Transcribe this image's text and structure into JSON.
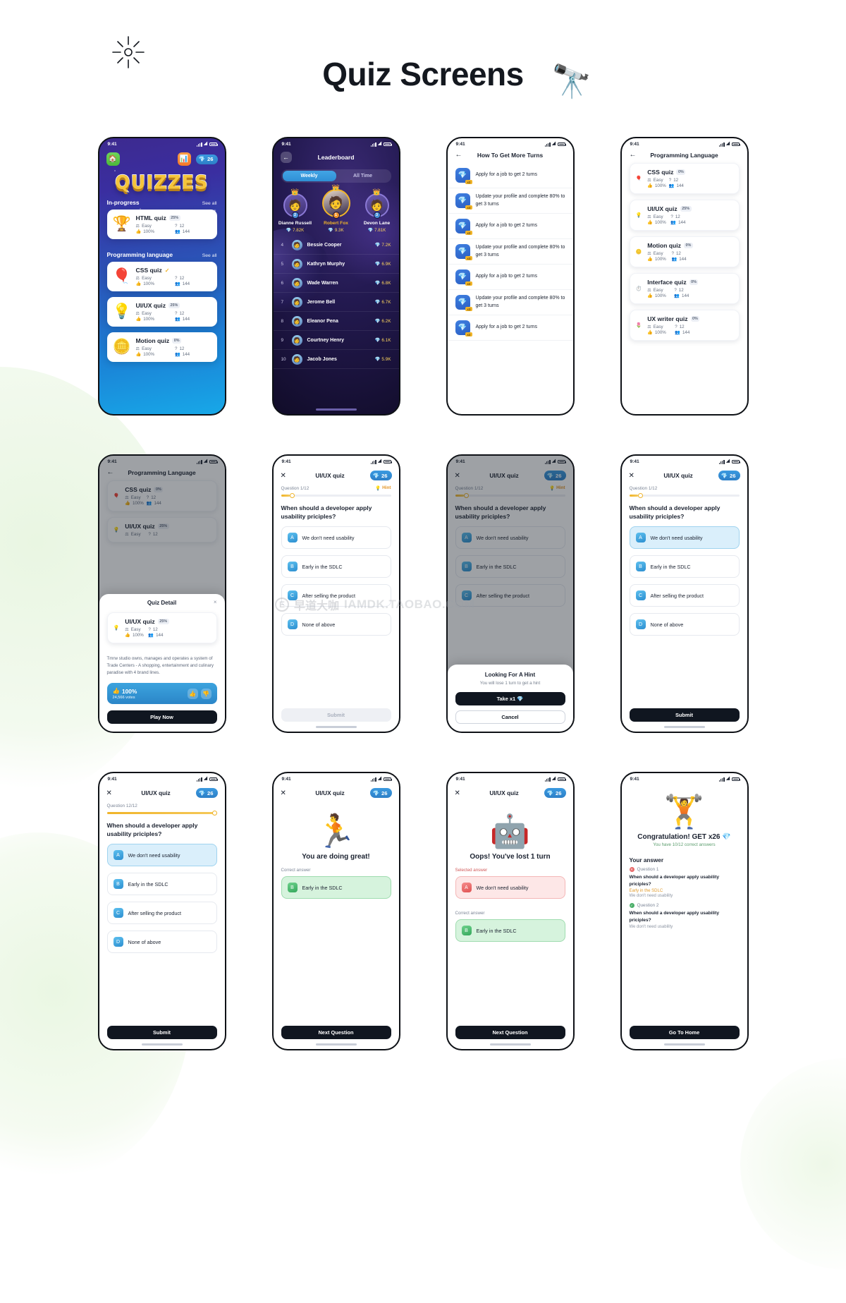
{
  "header": {
    "title": "Quiz Screens",
    "sun_icon": "sun-icon",
    "binoculars_icon": "🔭"
  },
  "watermark": {
    "logo": "E",
    "text_cn": "早道大咖",
    "text_en": "IAMDK.TAOBAO.COM"
  },
  "status_bar": {
    "time": "9:41"
  },
  "screen1": {
    "logo": "QUIZZES",
    "home_icon": "🏠",
    "ranking_icon": "📊",
    "gems": "26",
    "gem_icon": "💎",
    "sections": [
      {
        "title": "In-progress",
        "link": "See all"
      },
      {
        "title": "Programming language",
        "link": "See all"
      }
    ],
    "cards": [
      {
        "emoji": "🏆",
        "title": "HTML quiz",
        "badge": "25%",
        "difficulty": "Easy",
        "questions": "12",
        "rate": "100%",
        "players": "144"
      },
      {
        "emoji": "🎈",
        "title": "CSS quiz",
        "badge": "✓",
        "badge_done": true,
        "difficulty": "Easy",
        "questions": "12",
        "rate": "100%",
        "players": "144"
      },
      {
        "emoji": "💡",
        "title": "UI/UX quiz",
        "badge": "25%",
        "difficulty": "Easy",
        "questions": "12",
        "rate": "100%",
        "players": "144"
      },
      {
        "emoji": "🪙",
        "title": "Motion quiz",
        "badge": "0%",
        "difficulty": "Easy",
        "questions": "12",
        "rate": "100%",
        "players": "144"
      }
    ]
  },
  "screen2": {
    "title": "Leaderboard",
    "tabs": [
      {
        "label": "Weekly",
        "active": true
      },
      {
        "label": "All Time",
        "active": false
      }
    ],
    "podium": [
      {
        "rank": "2",
        "name": "Dianne Russell",
        "score": "7.82K",
        "avatar": "🧑",
        "crown": "👑"
      },
      {
        "rank": "1",
        "name": "Robert Fox",
        "score": "9.3K",
        "avatar": "🧑",
        "crown": "👑"
      },
      {
        "rank": "3",
        "name": "Devon Lane",
        "score": "7.81K",
        "avatar": "🧑",
        "crown": "👑"
      }
    ],
    "rows": [
      {
        "rank": "4",
        "name": "Bessie Cooper",
        "score": "7.2K",
        "avatar": "🧑"
      },
      {
        "rank": "5",
        "name": "Kathryn Murphy",
        "score": "6.9K",
        "avatar": "🧑"
      },
      {
        "rank": "6",
        "name": "Wade Warren",
        "score": "6.8K",
        "avatar": "🧑"
      },
      {
        "rank": "7",
        "name": "Jerome Bell",
        "score": "6.7K",
        "avatar": "👩"
      },
      {
        "rank": "8",
        "name": "Eleanor Pena",
        "score": "6.2K",
        "avatar": "👩"
      },
      {
        "rank": "9",
        "name": "Courtney Henry",
        "score": "6.1K",
        "avatar": "👩"
      },
      {
        "rank": "10",
        "name": "Jacob Jones",
        "score": "5.9K",
        "avatar": "🧑"
      }
    ]
  },
  "screen3": {
    "title": "How To Get More Turns",
    "gem_icon": "💎",
    "items": [
      {
        "text": "Apply for a job to get 2 turns",
        "mult": "x2"
      },
      {
        "text": "Update your profile and complete 80% to get 3 turns",
        "mult": "x3"
      },
      {
        "text": "Apply for a job to get 2 turns",
        "mult": "x2"
      },
      {
        "text": "Update your profile and complete 80% to get 3 turns",
        "mult": "x3"
      },
      {
        "text": "Apply for a job to get 2 turns",
        "mult": "x2"
      },
      {
        "text": "Update your profile and complete 80% to get 3 turns",
        "mult": "x3"
      },
      {
        "text": "Apply for a job to get 2 turns",
        "mult": "x2"
      }
    ]
  },
  "screen4": {
    "title": "Programming Language",
    "cards": [
      {
        "emoji": "🎈",
        "title": "CSS quiz",
        "badge": "0%",
        "difficulty": "Easy",
        "questions": "12",
        "rate": "100%",
        "players": "144"
      },
      {
        "emoji": "💡",
        "title": "UI/UX quiz",
        "badge": "25%",
        "difficulty": "Easy",
        "questions": "12",
        "rate": "100%",
        "players": "144"
      },
      {
        "emoji": "🪙",
        "title": "Motion quiz",
        "badge": "0%",
        "difficulty": "Easy",
        "questions": "12",
        "rate": "100%",
        "players": "144"
      },
      {
        "emoji": "⏱️",
        "title": "Interface quiz",
        "badge": "0%",
        "difficulty": "Easy",
        "questions": "12",
        "rate": "100%",
        "players": "144"
      },
      {
        "emoji": "🌷",
        "title": "UX writer quiz",
        "badge": "0%",
        "difficulty": "Easy",
        "questions": "12",
        "rate": "100%",
        "players": "144"
      }
    ]
  },
  "screen5": {
    "title": "Programming Language",
    "sheet_title": "Quiz Detail",
    "close_icon": "×",
    "card": {
      "emoji": "💡",
      "title": "UI/UX quiz",
      "badge": "25%",
      "difficulty": "Easy",
      "questions": "12",
      "rate": "100%",
      "players": "144"
    },
    "description": "Tmrw studio owns, manages and operates a system of Trade Centers - A shopping, entertainment and culinary paradise with 4 brand lines.",
    "vote_pct": "100%",
    "vote_count": "24,566 votes",
    "thumbs_up": "👍",
    "thumbs_down": "👎",
    "play_button": "Play Now"
  },
  "screen6": {
    "title": "UI/UX quiz",
    "gems": "26",
    "progress_label": "Question 1/12",
    "progress_pct": 8,
    "hint_label": "Hint",
    "hint_icon": "💡",
    "question": "When should a developer apply usability priciples?",
    "options": [
      {
        "label": "We don't need usability",
        "icon": "A",
        "state": ""
      },
      {
        "label": "Early in the SDLC",
        "icon": "B",
        "state": ""
      },
      {
        "label": "After selling the product",
        "icon": "C",
        "state": ""
      },
      {
        "label": "None of above",
        "icon": "D",
        "state": ""
      }
    ],
    "submit_label": "Submit",
    "submit_disabled": true
  },
  "screen7": {
    "title": "UI/UX quiz",
    "gems": "26",
    "progress_label": "Question 1/12",
    "progress_pct": 8,
    "hint_label": "Hint",
    "question": "When should a developer apply usability priciples?",
    "options": [
      {
        "label": "We don't need usability",
        "icon": "A"
      },
      {
        "label": "Early in the SDLC",
        "icon": "B"
      },
      {
        "label": "After selling the product",
        "icon": "C"
      }
    ],
    "modal": {
      "title": "Looking For A Hint",
      "subtitle": "You will lose 1 turn to get a hint",
      "primary": "Take x1 💎",
      "secondary": "Cancel"
    }
  },
  "screen8": {
    "title": "UI/UX quiz",
    "gems": "26",
    "progress_label": "Question 1/12",
    "progress_pct": 8,
    "question": "When should a developer apply usability priciples?",
    "options": [
      {
        "label": "We don't need usability",
        "icon": "A",
        "state": "selected"
      },
      {
        "label": "Early in the SDLC",
        "icon": "B",
        "state": ""
      },
      {
        "label": "After selling the product",
        "icon": "C",
        "state": ""
      },
      {
        "label": "None of above",
        "icon": "D",
        "state": ""
      }
    ],
    "submit_label": "Submit"
  },
  "screen9": {
    "title": "UI/UX quiz",
    "gems": "26",
    "progress_label": "Question 12/12",
    "progress_pct": 100,
    "question": "When should a developer apply usability priciples?",
    "options": [
      {
        "label": "We don't need usability",
        "icon": "A",
        "state": "selected"
      },
      {
        "label": "Early in the SDLC",
        "icon": "B",
        "state": ""
      },
      {
        "label": "After selling the product",
        "icon": "C",
        "state": ""
      },
      {
        "label": "None of above",
        "icon": "D",
        "state": ""
      }
    ],
    "submit_label": "Submit"
  },
  "screen10": {
    "title": "UI/UX quiz",
    "gems": "26",
    "illustration": "🏃",
    "result_title": "You are doing great!",
    "answer_label": "Correct answer",
    "answer": {
      "label": "Early in the SDLC",
      "icon": "B"
    },
    "next_button": "Next Question"
  },
  "screen11": {
    "title": "UI/UX quiz",
    "gems": "26",
    "illustration": "🤖",
    "result_title": "Oops! You've lost 1 turn",
    "selected_label": "Selected answer",
    "selected": {
      "label": "We don't need usability",
      "icon": "A"
    },
    "correct_label": "Correct answer",
    "correct": {
      "label": "Early in the SDLC",
      "icon": "B"
    },
    "next_button": "Next Question"
  },
  "screen12": {
    "illustration": "🏋️",
    "congrats_title": "Congratulation! GET x26 💎",
    "congrats_sub": "You have 10/12 correct answers",
    "answers_head": "Your answer",
    "answers": [
      {
        "badge": "Question 1",
        "status": "bad",
        "question": "When should a developer apply usability priciples?",
        "correct_label": "Early in the SDLC",
        "given_label": "We don't need usability"
      },
      {
        "badge": "Question 2",
        "status": "good",
        "question": "When should a developer apply usability priciples?",
        "correct_label": "",
        "given_label": "We don't need usability"
      }
    ],
    "home_button": "Go To Home"
  }
}
